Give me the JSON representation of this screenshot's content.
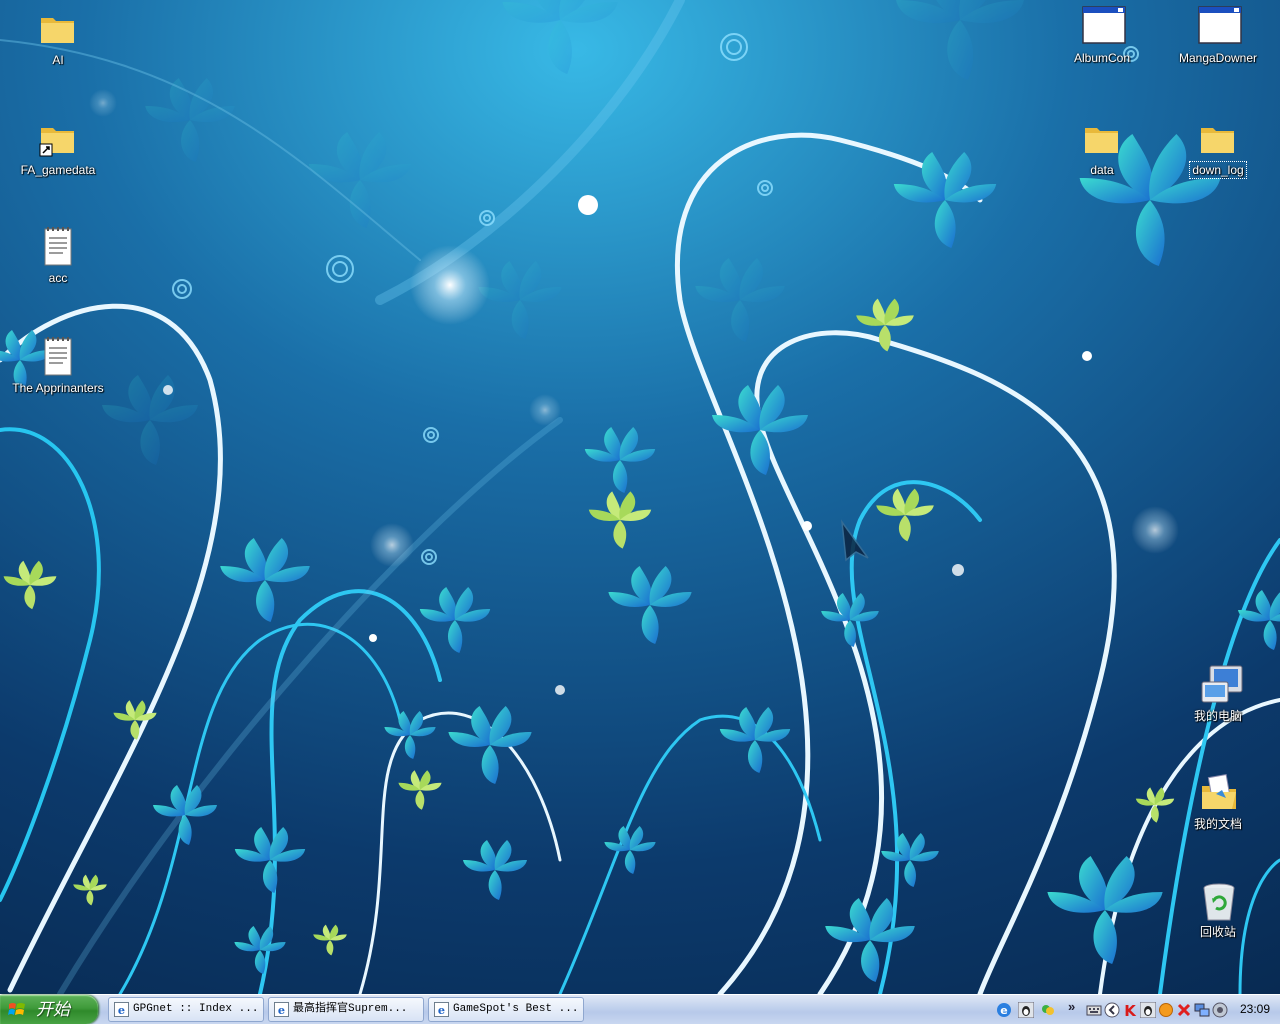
{
  "desktop": {
    "icons_left": [
      {
        "label": "AI",
        "type": "folder"
      },
      {
        "label": "FA_gamedata",
        "type": "folder-shortcut"
      },
      {
        "label": "acc",
        "type": "text-file"
      },
      {
        "label": "The Apprinanters",
        "type": "text-file"
      }
    ],
    "icons_right_top": [
      {
        "label": "AlbumCon",
        "type": "app-window"
      },
      {
        "label": "MangaDowner",
        "type": "app-window"
      },
      {
        "label": "data",
        "type": "folder"
      },
      {
        "label": "down_log",
        "type": "folder"
      }
    ],
    "icons_right_bottom": [
      {
        "label": "我的电脑",
        "type": "my-computer"
      },
      {
        "label": "我的文档",
        "type": "my-documents"
      },
      {
        "label": "回收站",
        "type": "recycle-bin"
      }
    ]
  },
  "taskbar": {
    "start_label": "开始",
    "tasks": [
      {
        "label": "GPGnet :: Index ..."
      },
      {
        "label": "最高指挥官Suprem..."
      },
      {
        "label": "GameSpot's Best ..."
      }
    ],
    "tray_chevron": "»",
    "clock": "23:09"
  },
  "colors": {
    "wallpaper_dark": "#0b2f57",
    "wallpaper_light": "#29a8d8",
    "leaf_cyan": "#22c4c8",
    "leaf_green": "#b8e06a",
    "start_green": "#3f9a3a",
    "taskbar_blue": "#c3d3ee"
  }
}
